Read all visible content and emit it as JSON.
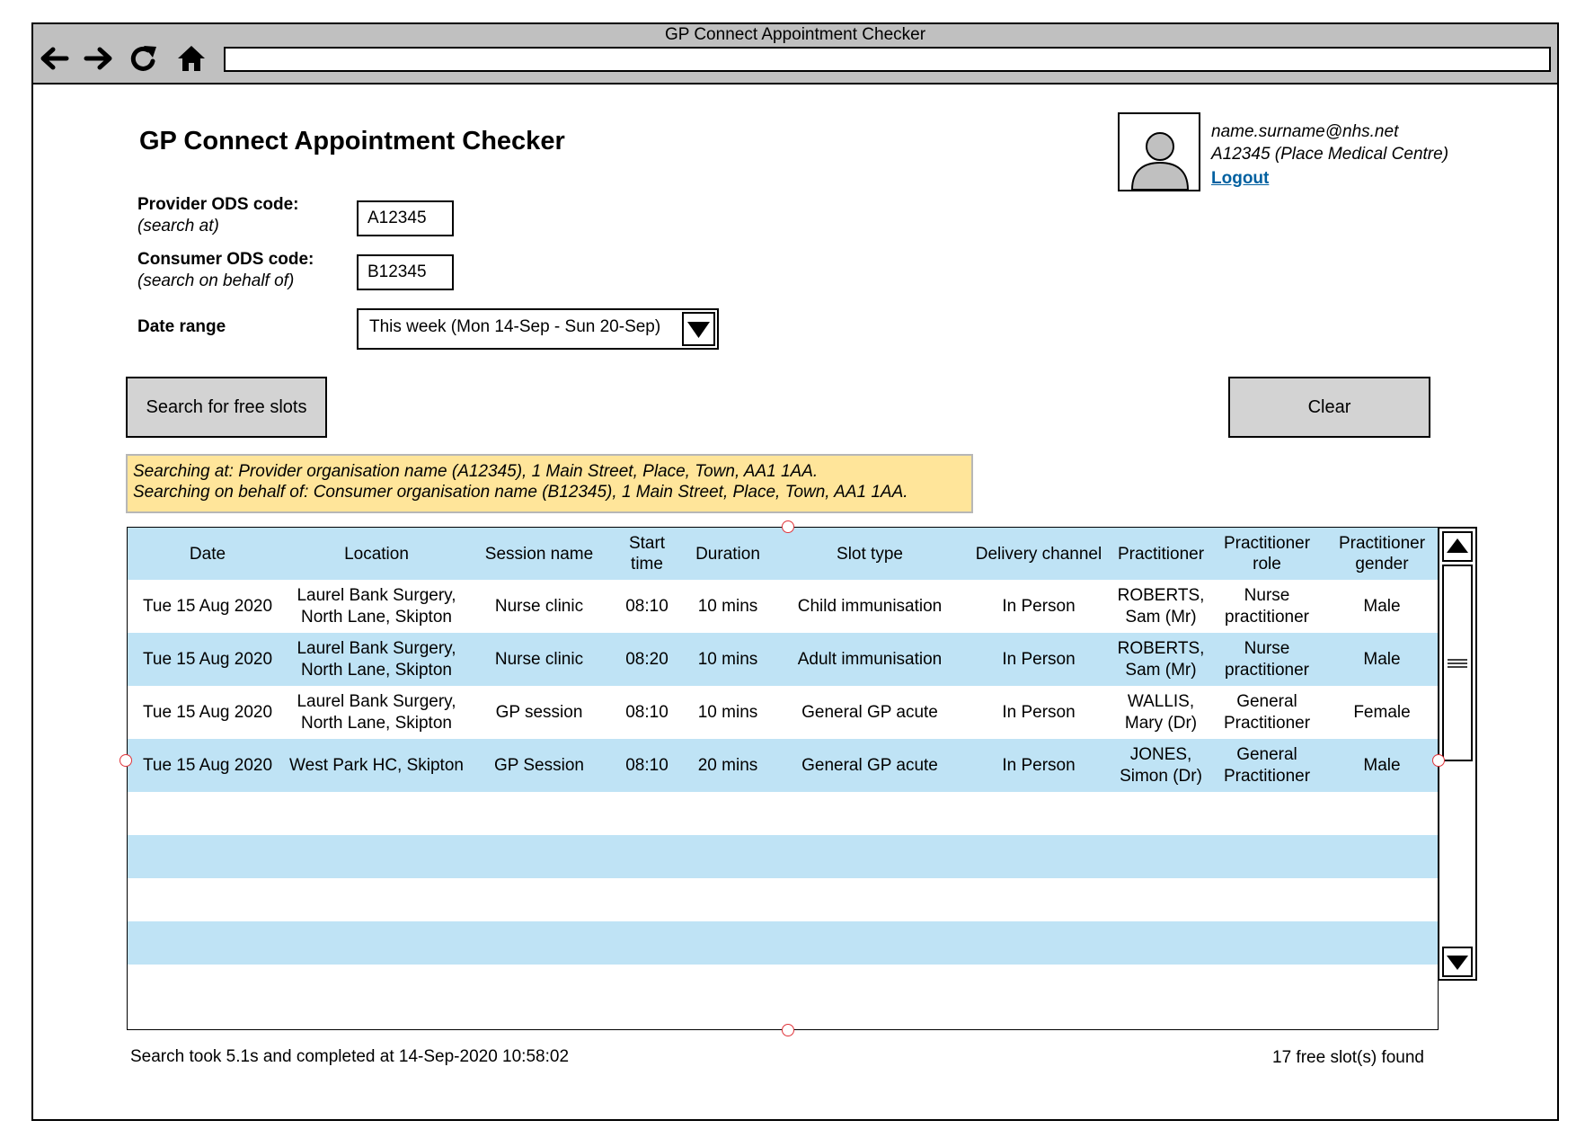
{
  "window": {
    "title": "GP Connect Appointment Checker",
    "address": ""
  },
  "header": {
    "title": "GP Connect Appointment Checker"
  },
  "user": {
    "email": "name.surname@nhs.net",
    "organisation": "A12345 (Place Medical Centre)",
    "logout_label": "Logout"
  },
  "form": {
    "provider_label": "Provider ODS code:",
    "provider_sub": "(search at)",
    "provider_value": "A12345",
    "consumer_label": "Consumer ODS code:",
    "consumer_sub": "(search on behalf of)",
    "consumer_value": "B12345",
    "date_range_label": "Date range",
    "date_range_value": "This week (Mon 14-Sep - Sun 20-Sep)"
  },
  "buttons": {
    "search_label": "Search for free slots",
    "clear_label": "Clear"
  },
  "info": {
    "line1": "Searching at:  Provider organisation name (A12345), 1 Main Street, Place, Town, AA1 1AA.",
    "line2": "Searching on behalf of:  Consumer organisation name (B12345), 1 Main Street, Place, Town, AA1 1AA."
  },
  "table": {
    "columns": [
      "Date",
      "Location",
      "Session name",
      "Start time",
      "Duration",
      "Slot type",
      "Delivery channel",
      "Practitioner",
      "Practitioner role",
      "Practitioner gender"
    ],
    "rows": [
      [
        "Tue 15 Aug 2020",
        "Laurel Bank Surgery, North Lane, Skipton",
        "Nurse clinic",
        "08:10",
        "10 mins",
        "Child immunisation",
        "In Person",
        "ROBERTS, Sam (Mr)",
        "Nurse practitioner",
        "Male"
      ],
      [
        "Tue 15 Aug 2020",
        "Laurel Bank Surgery, North Lane, Skipton",
        "Nurse clinic",
        "08:20",
        "10 mins",
        "Adult immunisation",
        "In Person",
        "ROBERTS, Sam (Mr)",
        "Nurse practitioner",
        "Male"
      ],
      [
        "Tue 15 Aug 2020",
        "Laurel Bank Surgery, North Lane, Skipton",
        "GP session",
        "08:10",
        "10 mins",
        "General GP acute",
        "In Person",
        "WALLIS, Mary (Dr)",
        "General Practitioner",
        "Female"
      ],
      [
        "Tue 15 Aug 2020",
        "West Park HC, Skipton",
        "GP Session",
        "08:10",
        "20 mins",
        "General GP acute",
        "In Person",
        "JONES, Simon (Dr)",
        "General Practitioner",
        "Male"
      ]
    ]
  },
  "footer": {
    "search_info": "Search took 5.1s and completed at 14-Sep-2020 10:58:02",
    "result_count": "17 free slot(s) found"
  },
  "colors": {
    "row_highlight": "#bfe3f5",
    "info_background": "#ffe59a",
    "button_background": "#d3d3d3",
    "link": "#0060a0",
    "chrome": "#c0c0c0"
  },
  "icons": {
    "nav": [
      "back-arrow-icon",
      "forward-arrow-icon",
      "reload-icon",
      "home-icon"
    ],
    "user": "user-avatar-icon",
    "dropdown": "triangle-down-icon",
    "scroll": [
      "scroll-up-icon",
      "scroll-down-icon",
      "scroll-grip-icon"
    ]
  }
}
